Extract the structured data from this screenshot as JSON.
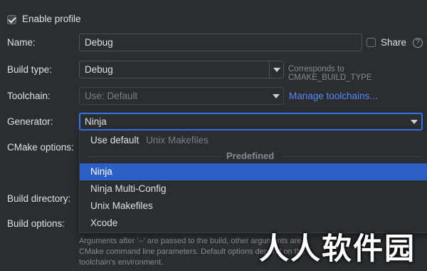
{
  "enable_profile": {
    "label": "Enable profile",
    "checked": true
  },
  "name": {
    "label": "Name:",
    "value": "Debug",
    "share_label": "Share",
    "help": "?"
  },
  "build_type": {
    "label": "Build type:",
    "value": "Debug",
    "hint": "Corresponds to CMAKE_BUILD_TYPE"
  },
  "toolchain": {
    "label": "Toolchain:",
    "value": "Use: Default",
    "link": "Manage toolchains..."
  },
  "generator": {
    "label": "Generator:",
    "value": "Ninja",
    "dropdown": {
      "default_option": {
        "label": "Use default",
        "hint": "Unix Makefiles"
      },
      "section_title": "Predefined",
      "options": [
        "Ninja",
        "Ninja Multi-Config",
        "Unix Makefiles",
        "Xcode"
      ],
      "selected": "Ninja"
    }
  },
  "cmake_options": {
    "label": "CMake options:"
  },
  "build_directory": {
    "label": "Build directory:"
  },
  "build_options": {
    "label": "Build options:",
    "note_lines": [
      "Arguments after '--' are passed to the build, other arguments are",
      "CMake command line parameters. Default options depend on the",
      "toolchain's environment."
    ]
  },
  "watermark": "人人软件园"
}
